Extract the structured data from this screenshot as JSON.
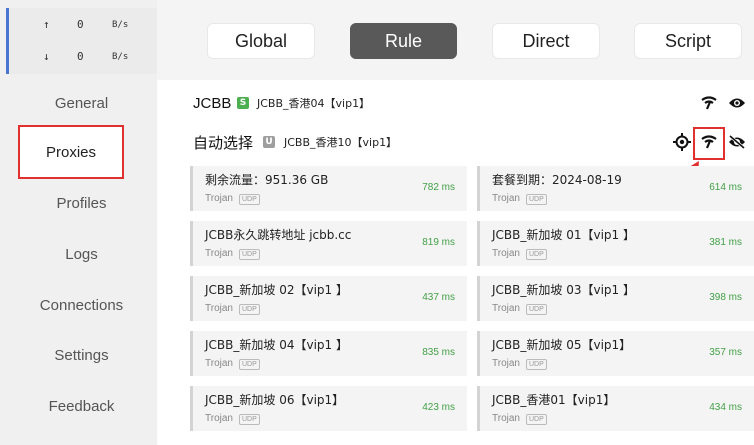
{
  "speed": {
    "upload": {
      "arrow": "↑",
      "value": "0",
      "unit": "B/s"
    },
    "download": {
      "arrow": "↓",
      "value": "0",
      "unit": "B/s"
    }
  },
  "nav": {
    "items": [
      {
        "label": "General"
      },
      {
        "label": "Proxies"
      },
      {
        "label": "Profiles"
      },
      {
        "label": "Logs"
      },
      {
        "label": "Connections"
      },
      {
        "label": "Settings"
      },
      {
        "label": "Feedback"
      }
    ],
    "active": "Proxies"
  },
  "modes": [
    {
      "label": "Global"
    },
    {
      "label": "Rule"
    },
    {
      "label": "Direct"
    },
    {
      "label": "Script"
    }
  ],
  "active_mode": "Rule",
  "groups": [
    {
      "name": "JCBB",
      "badge": "S",
      "badge_color": "#4caf50",
      "current": "JCBB_香港04【vip1】",
      "icons": [
        "wifi-latency-icon",
        "eye-icon"
      ]
    },
    {
      "name": "自动选择",
      "badge": "U",
      "badge_color": "#9e9e9e",
      "current": "JCBB_香港10【vip1】",
      "icons": [
        "locate-icon",
        "wifi-latency-icon",
        "eye-off-icon"
      ]
    }
  ],
  "proxies": [
    {
      "name": "剩余流量：951.36 GB",
      "type": "Trojan",
      "udp": "UDP",
      "latency": "782 ms"
    },
    {
      "name": "套餐到期：2024-08-19",
      "type": "Trojan",
      "udp": "UDP",
      "latency": "614 ms"
    },
    {
      "name": "JCBB永久跳转地址 jcbb.cc",
      "type": "Trojan",
      "udp": "UDP",
      "latency": "819 ms"
    },
    {
      "name": "JCBB_新加坡 01【vip1 】",
      "type": "Trojan",
      "udp": "UDP",
      "latency": "381 ms"
    },
    {
      "name": "JCBB_新加坡 02【vip1 】",
      "type": "Trojan",
      "udp": "UDP",
      "latency": "437 ms"
    },
    {
      "name": "JCBB_新加坡 03【vip1 】",
      "type": "Trojan",
      "udp": "UDP",
      "latency": "398 ms"
    },
    {
      "name": "JCBB_新加坡 04【vip1 】",
      "type": "Trojan",
      "udp": "UDP",
      "latency": "835 ms"
    },
    {
      "name": "JCBB_新加坡 05【vip1】",
      "type": "Trojan",
      "udp": "UDP",
      "latency": "357 ms"
    },
    {
      "name": "JCBB_新加坡 06【vip1】",
      "type": "Trojan",
      "udp": "UDP",
      "latency": "423 ms"
    },
    {
      "name": "JCBB_香港01【vip1】",
      "type": "Trojan",
      "udp": "UDP",
      "latency": "434 ms"
    }
  ],
  "colors": {
    "highlight": "#e0312f",
    "latency": "#43a047",
    "accent": "#4a76d1"
  }
}
